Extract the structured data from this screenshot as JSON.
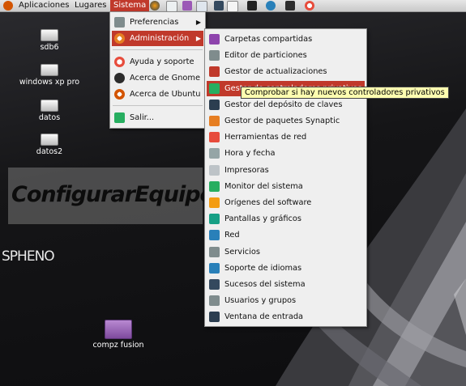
{
  "panel": {
    "menus": [
      "Aplicaciones",
      "Lugares",
      "Sistema"
    ],
    "launchers": [
      "firefox-icon",
      "mail-icon",
      "help-icon",
      "document-icon",
      "settings-icon",
      "inkscape-icon",
      "clock-icon",
      "terminal-icon",
      "lifesaver-icon"
    ]
  },
  "desktop": {
    "icons": [
      "sdb6",
      "windows xp pro",
      "datos",
      "datos2"
    ],
    "folder": "compz fusion",
    "logo": "ConfigurarEquipos",
    "spheno": "SPHENO"
  },
  "sistema_menu": {
    "items": [
      "Preferencias",
      "Administración",
      "Ayuda y soporte",
      "Acerca de Gnome",
      "Acerca de Ubuntu",
      "Salir..."
    ]
  },
  "admin_menu": {
    "items": [
      "Carpetas compartidas",
      "Editor de particiones",
      "Gestor de actualizaciones",
      "Gestor de controladores privativos",
      "Gestor del depósito de claves",
      "Gestor de paquetes Synaptic",
      "Herramientas de red",
      "Hora y fecha",
      "Impresoras",
      "Monitor del sistema",
      "Orígenes del software",
      "Pantallas y gráficos",
      "Red",
      "Servicios",
      "Soporte de idiomas",
      "Sucesos del sistema",
      "Usuarios y grupos",
      "Ventana de entrada"
    ]
  },
  "tooltip": "Comprobar si hay nuevos controladores privativos",
  "colors": {
    "highlight": "#c0392b",
    "menu_bg": "#efefef",
    "tooltip_bg": "#fdfdb0"
  }
}
